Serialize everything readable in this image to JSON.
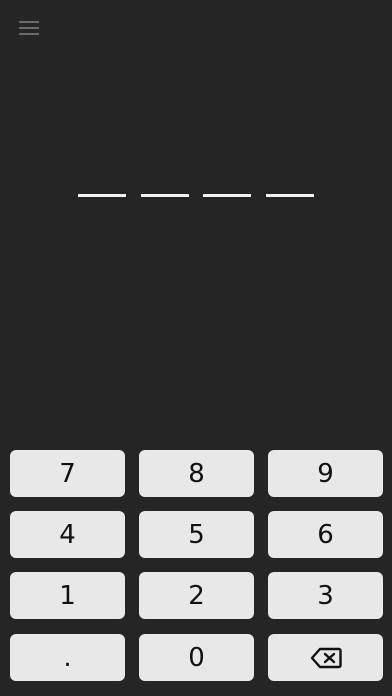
{
  "header": {
    "menu_icon": "hamburger-menu-icon"
  },
  "pin": {
    "slots": [
      "",
      "",
      "",
      ""
    ]
  },
  "keypad": {
    "keys": [
      {
        "label": "7"
      },
      {
        "label": "8"
      },
      {
        "label": "9"
      },
      {
        "label": "4"
      },
      {
        "label": "5"
      },
      {
        "label": "6"
      },
      {
        "label": "1"
      },
      {
        "label": "2"
      },
      {
        "label": "3"
      },
      {
        "label": "."
      },
      {
        "label": "0"
      },
      {
        "label": "",
        "icon": "backspace-icon"
      }
    ]
  },
  "colors": {
    "background": "#252525",
    "key_background": "#e8e8e8",
    "key_text": "#111111",
    "pin_slot": "#f2f2f2",
    "menu_icon": "#6a6a6a"
  }
}
